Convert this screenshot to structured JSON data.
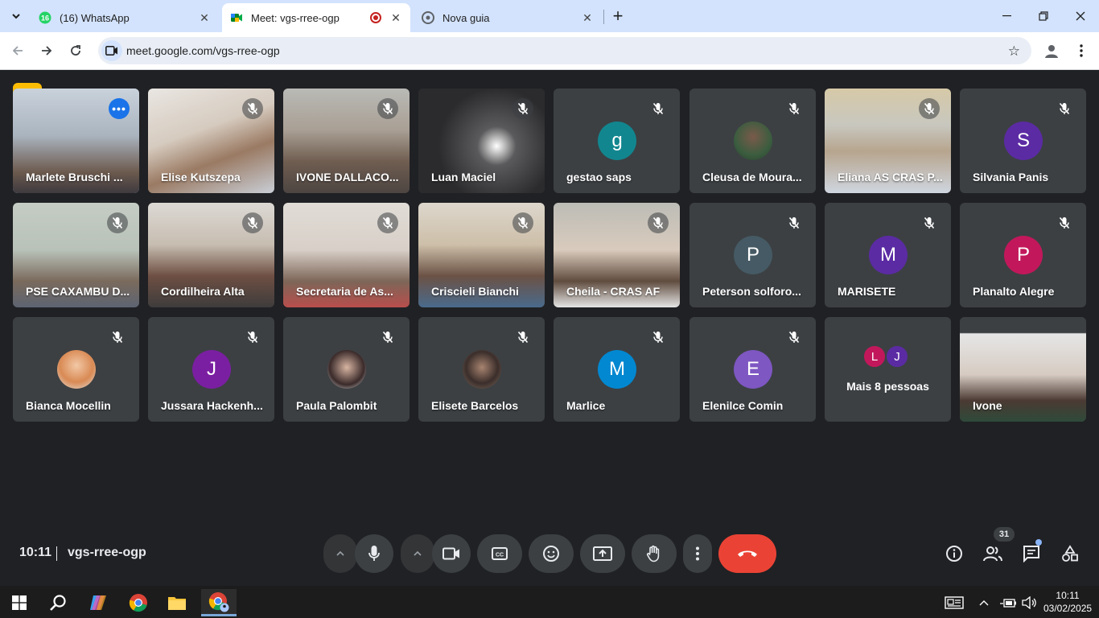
{
  "browser": {
    "tabs": [
      {
        "title": "(16) WhatsApp",
        "badge": "16"
      },
      {
        "title": "Meet: vgs-rree-ogp",
        "recording": true
      },
      {
        "title": "Nova guia"
      }
    ],
    "url": "meet.google.com/vgs-rree-ogp"
  },
  "meet": {
    "participants": [
      {
        "name": "Marlete Bruschi ...",
        "speaking": true
      },
      {
        "name": "Elise Kutszepa"
      },
      {
        "name": "IVONE DALLACO..."
      },
      {
        "name": "Luan Maciel"
      },
      {
        "name": "gestao saps",
        "initial": "g",
        "color": "#12868f"
      },
      {
        "name": "Cleusa de Moura..."
      },
      {
        "name": "Eliana AS CRAS P..."
      },
      {
        "name": "Silvania Panis",
        "initial": "S",
        "color": "#5b2ba3"
      },
      {
        "name": "PSE CAXAMBU D..."
      },
      {
        "name": "Cordilheira Alta"
      },
      {
        "name": "Secretaria de As..."
      },
      {
        "name": "Criscieli Bianchi"
      },
      {
        "name": "Cheila - CRAS AF"
      },
      {
        "name": "Peterson solforo...",
        "initial": "P",
        "color": "#455a64"
      },
      {
        "name": "MARISETE",
        "initial": "M",
        "color": "#5b2ba3"
      },
      {
        "name": "Planalto Alegre",
        "initial": "P",
        "color": "#c2185b"
      },
      {
        "name": "Bianca Mocellin"
      },
      {
        "name": "Jussara Hackenh...",
        "initial": "J",
        "color": "#7b1fa2"
      },
      {
        "name": "Paula Palombit"
      },
      {
        "name": "Elisete Barcelos"
      },
      {
        "name": "Marlice",
        "initial": "M",
        "color": "#0288d1"
      },
      {
        "name": "Elenilce Comin",
        "initial": "E",
        "color": "#7e57c2"
      },
      {
        "name": "Ivone"
      }
    ],
    "more_people": {
      "label": "Mais 8 pessoas",
      "initials": [
        "L",
        "J"
      ],
      "colors": [
        "#c2185b",
        "#5b2ba3"
      ]
    },
    "time": "10:11",
    "meeting_code": "vgs-rree-ogp",
    "people_count": "31"
  },
  "taskbar": {
    "time": "10:11",
    "date": "03/02/2025"
  }
}
